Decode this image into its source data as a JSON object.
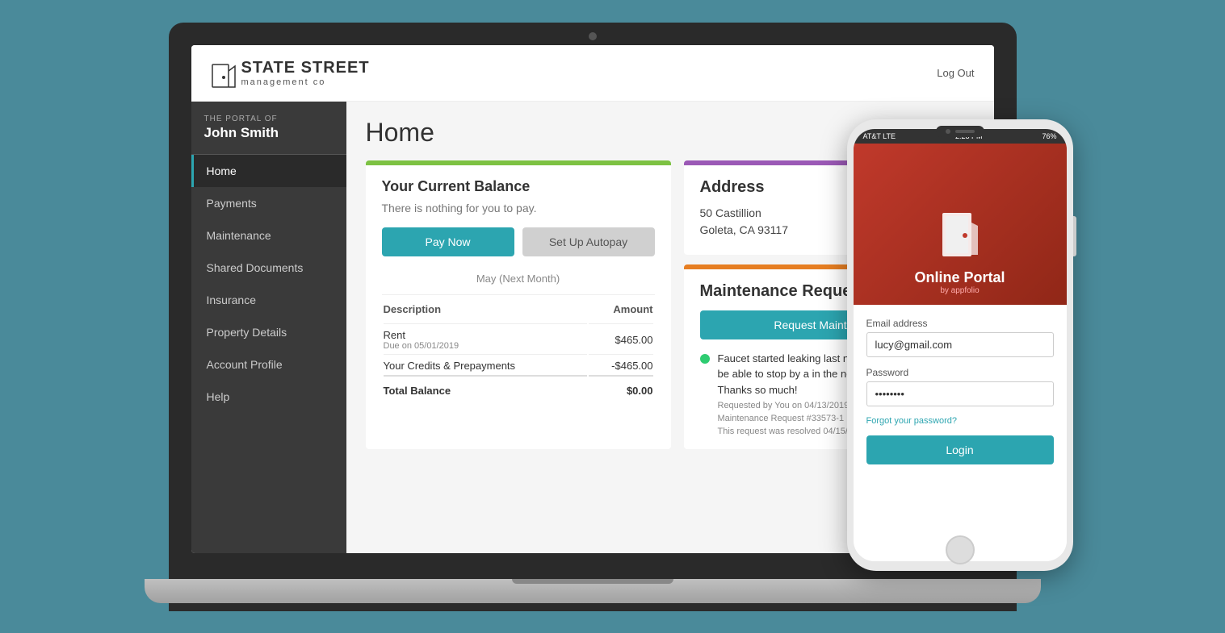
{
  "app": {
    "title": "Home",
    "logo": {
      "brand_line1": "STATE STREET",
      "brand_line2": "management co"
    },
    "header": {
      "logout_label": "Log Out"
    }
  },
  "sidebar": {
    "user_label": "THE PORTAL OF",
    "user_name": "John Smith",
    "items": [
      {
        "label": "Home",
        "active": true
      },
      {
        "label": "Payments",
        "active": false
      },
      {
        "label": "Maintenance",
        "active": false
      },
      {
        "label": "Shared Documents",
        "active": false
      },
      {
        "label": "Insurance",
        "active": false
      },
      {
        "label": "Property Details",
        "active": false
      },
      {
        "label": "Account Profile",
        "active": false
      },
      {
        "label": "Help",
        "active": false
      }
    ]
  },
  "main": {
    "page_title": "Home",
    "balance_card": {
      "title": "Your Current Balance",
      "note": "There is nothing for you to pay.",
      "pay_now_label": "Pay Now",
      "autopay_label": "Set Up Autopay",
      "month_label": "May (Next Month)",
      "table_headers": {
        "description": "Description",
        "amount": "Amount"
      },
      "rows": [
        {
          "label": "Rent",
          "sublabel": "Due on 05/01/2019",
          "amount": "$465.00"
        },
        {
          "label": "Your Credits & Prepayments",
          "sublabel": "",
          "amount": "-$465.00"
        }
      ],
      "total_label": "Total Balance",
      "total_amount": "$0.00"
    },
    "address_card": {
      "title": "Address",
      "line1": "50 Castillion",
      "line2": "Goleta, CA 93117"
    },
    "maintenance_card": {
      "title": "Maintenance Requests",
      "request_btn_label": "Request Maintenance",
      "request": {
        "text": "Faucet started leaking last night. Would someone be able to stop by a in the next few days?\nThanks so much!",
        "meta1": "Requested by You on 04/13/2019",
        "meta2": "Maintenance Request #33573-1",
        "meta3": "This request was resolved 04/15/2019",
        "status": "resolved"
      }
    }
  },
  "phone": {
    "status_bar": {
      "carrier": "AT&T LTE",
      "time": "2:28 PM",
      "battery": "76%"
    },
    "hero": {
      "title": "Online Portal",
      "sub": "by appfolio"
    },
    "login_form": {
      "email_label": "Email address",
      "email_value": "lucy@gmail.com",
      "password_label": "Password",
      "password_value": "••••••••",
      "forgot_label": "Forgot your password?",
      "login_btn_label": "Login"
    }
  }
}
